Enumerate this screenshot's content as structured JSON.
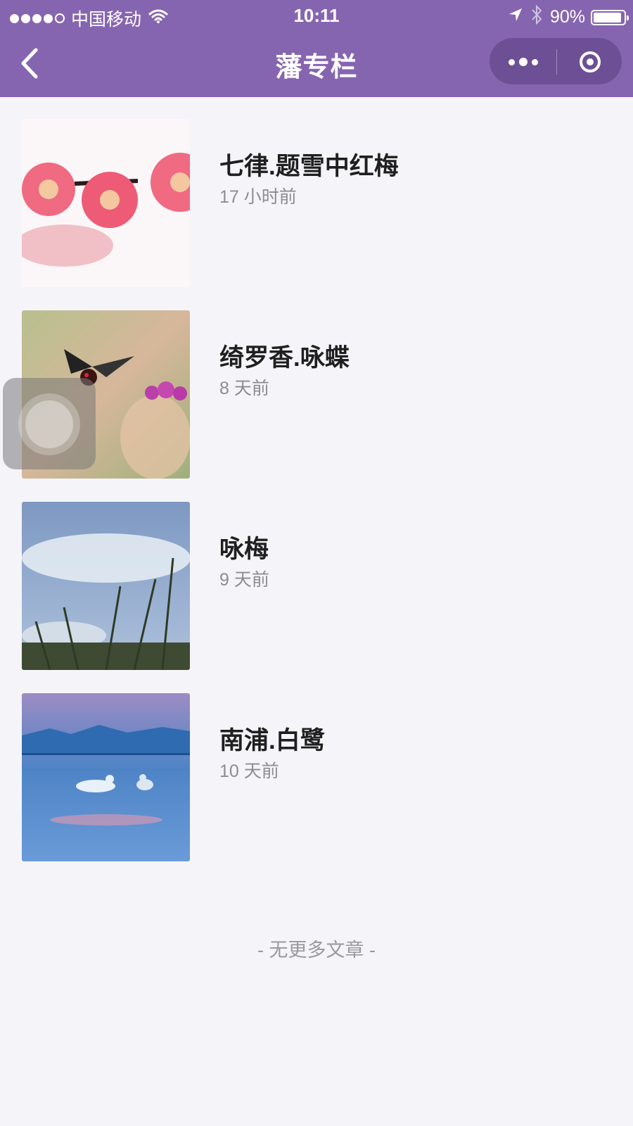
{
  "status_bar": {
    "carrier": "中国移动",
    "time": "10:11",
    "battery": "90%"
  },
  "nav": {
    "title": "藩专栏"
  },
  "articles": [
    {
      "title": "七律.题雪中红梅",
      "time": "17 小时前"
    },
    {
      "title": "绮罗香.咏蝶",
      "time": "8 天前"
    },
    {
      "title": "咏梅",
      "time": "9 天前"
    },
    {
      "title": "南浦.白鹭",
      "time": "10 天前"
    }
  ],
  "footer": "- 无更多文章 -",
  "colors": {
    "header": "#8665b0",
    "capsule": "#6d4f96",
    "background": "#f5f4f8"
  },
  "icons": [
    "signal-dots-icon",
    "wifi-icon",
    "location-arrow-icon",
    "bluetooth-icon",
    "battery-icon",
    "back-chevron-icon",
    "more-dots-icon",
    "close-ring-icon"
  ]
}
